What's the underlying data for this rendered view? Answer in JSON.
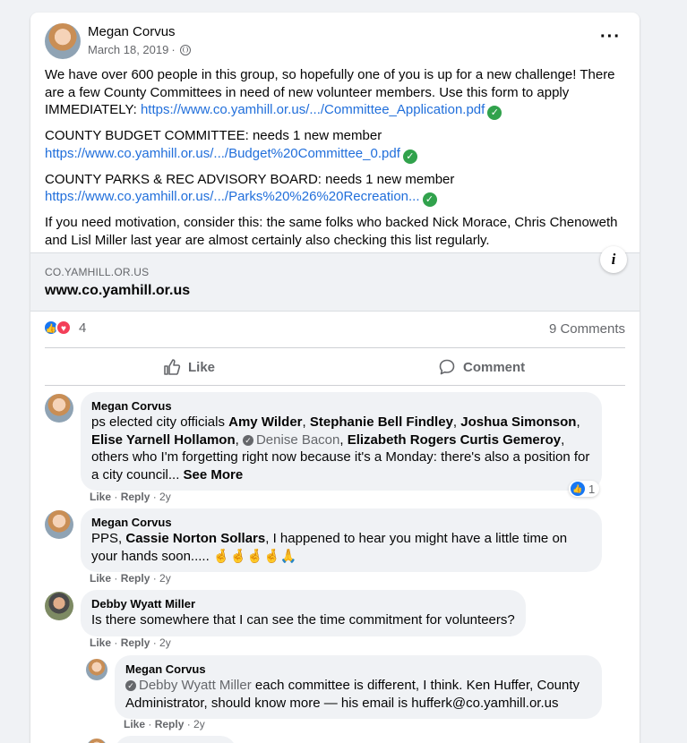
{
  "post": {
    "author": "Megan Corvus",
    "date": "March 18, 2019",
    "privacy_icon": "globe-icon",
    "para1": "We have over 600 people in this group, so hopefully one of you is up for a new challenge!  There are a few County Committees in need of new volunteer members.  Use this form to apply IMMEDIATELY:  ",
    "link1": "https://www.co.yamhill.or.us/.../Committee_Application.pdf",
    "para2": "COUNTY BUDGET COMMITTEE: needs 1 new member",
    "link2": "https://www.co.yamhill.or.us/.../Budget%20Committee_0.pdf",
    "para3": "COUNTY PARKS & REC ADVISORY BOARD: needs 1 new member",
    "link3": "https://www.co.yamhill.or.us/.../Parks%20%26%20Recreation...",
    "para4": "If you need motivation, consider this:  the same folks who backed Nick Morace, Chris Chenoweth and Lisl Miller last year are almost certainly also checking this list regularly."
  },
  "preview": {
    "domain": "CO.YAMHILL.OR.US",
    "title": "www.co.yamhill.or.us",
    "info_label": "i"
  },
  "reactions": {
    "count": "4",
    "comments": "9 Comments"
  },
  "actions": {
    "like": "Like",
    "comment": "Comment"
  },
  "comments": [
    {
      "name": "Megan Corvus",
      "t0": "ps elected city officials ",
      "m1": "Amy Wilder",
      "t1": ", ",
      "m2": "Stephanie Bell Findley",
      "t2": ", ",
      "m3": "Joshua Simonson",
      "t3": ", ",
      "m4": "Elise Yarnell Hollamon",
      "t4": ", ",
      "m5": "Denise Bacon",
      "t5": ", ",
      "m6": "Elizabeth Rogers Curtis Gemeroy",
      "t6": ", others who I'm forgetting right now because it's a Monday: there's also a position for a city council... ",
      "see_more": "See More",
      "like": "Like",
      "reply": "Reply",
      "age": "2y",
      "reaction_count": "1"
    },
    {
      "name": "Megan Corvus",
      "t0": "PPS, ",
      "m1": "Cassie Norton Sollars",
      "t1": ", I happened to hear you might have a little time on your hands soon..... ",
      "emoji": "🤞🤞🤞🤞🙏",
      "like": "Like",
      "reply": "Reply",
      "age": "2y"
    },
    {
      "name": "Debby Wyatt Miller",
      "text": "Is there somewhere that I can see the time commitment for volunteers?",
      "like": "Like",
      "reply": "Reply",
      "age": "2y"
    },
    {
      "name": "Megan Corvus",
      "mention": "Debby Wyatt Miller",
      "text": " each committee is different, I think. Ken Huffer, County Administrator, should know more — his email is hufferk@co.yamhill.or.us",
      "like": "Like",
      "reply": "Reply",
      "age": "2y"
    }
  ]
}
